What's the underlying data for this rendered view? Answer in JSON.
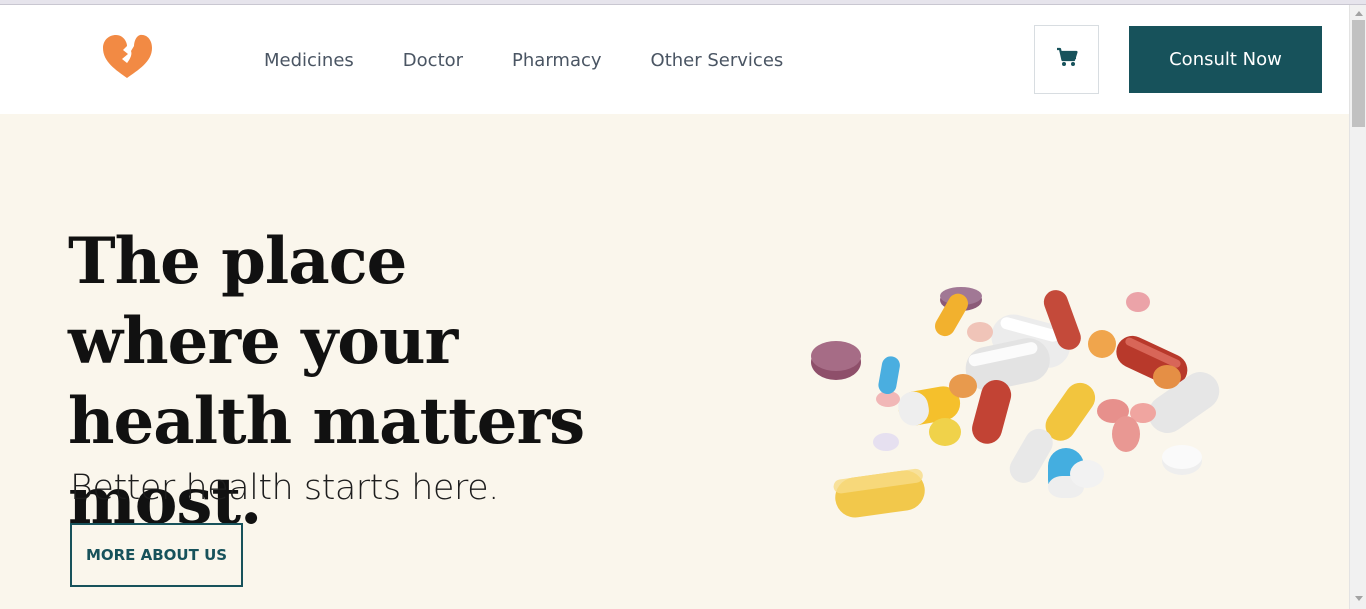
{
  "header": {
    "logo_icon": "heart-logo-icon",
    "nav": [
      {
        "label": "Medicines"
      },
      {
        "label": "Doctor"
      },
      {
        "label": "Pharmacy"
      },
      {
        "label": "Other Services"
      }
    ],
    "cart_icon": "cart-icon",
    "consult_label": "Consult Now"
  },
  "hero": {
    "headline": "The place where your health matters most.",
    "subline": "Better health starts here.",
    "more_label": "MORE ABOUT US",
    "image": "pile-of-pills-image"
  },
  "colors": {
    "brand_dark": "#17525b",
    "logo_orange": "#f28a44",
    "hero_bg": "#faf6ec"
  }
}
